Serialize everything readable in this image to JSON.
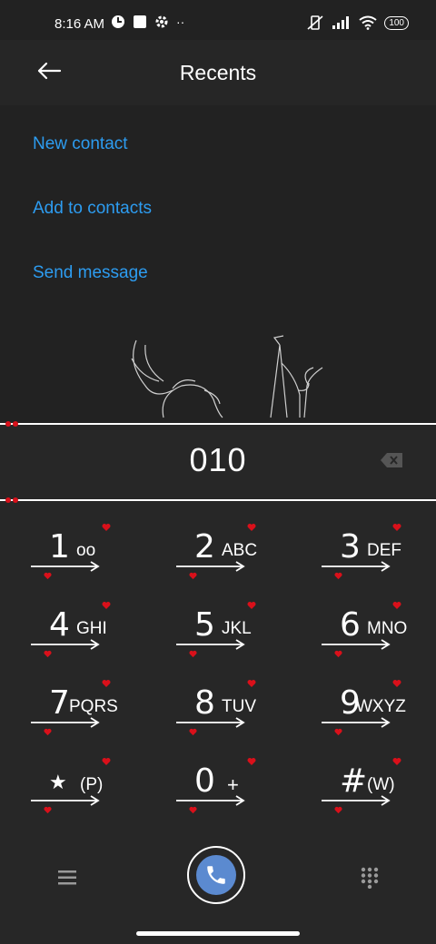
{
  "status": {
    "time": "8:16 AM",
    "battery": "100"
  },
  "header": {
    "title": "Recents"
  },
  "menu": {
    "items": [
      {
        "label": "New contact"
      },
      {
        "label": "Add to contacts"
      },
      {
        "label": "Send message"
      }
    ]
  },
  "dial": {
    "number": "010"
  },
  "keys": [
    {
      "digit": "1",
      "letters": "oo"
    },
    {
      "digit": "2",
      "letters": "ABC"
    },
    {
      "digit": "3",
      "letters": "DEF"
    },
    {
      "digit": "4",
      "letters": "GHI"
    },
    {
      "digit": "5",
      "letters": "JKL"
    },
    {
      "digit": "6",
      "letters": "MNO"
    },
    {
      "digit": "7",
      "letters": "PQRS"
    },
    {
      "digit": "8",
      "letters": "TUV"
    },
    {
      "digit": "9",
      "letters": "WXYZ"
    },
    {
      "digit": "★",
      "letters": "(P)"
    },
    {
      "digit": "0",
      "letters": "+"
    },
    {
      "digit": "#",
      "letters": "(W)"
    }
  ],
  "colors": {
    "accent": "#2d9cf0",
    "call": "#5b8ad0",
    "heart": "#d9101a"
  }
}
